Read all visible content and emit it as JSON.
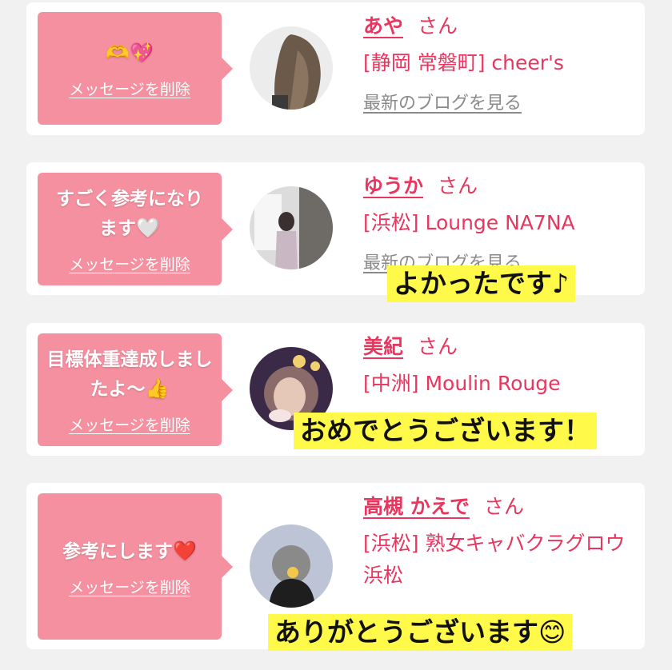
{
  "cards": [
    {
      "message": "",
      "message_emoji": "🫶💖",
      "delete_label": "メッセージを削除",
      "name": "あや",
      "honorific": "さん",
      "shop": "[静岡 常磐町] cheer's",
      "blog_link": "最新のブログを見る"
    },
    {
      "message": "すごく参考になります",
      "message_emoji": "🤍",
      "delete_label": "メッセージを削除",
      "name": "ゆうか",
      "honorific": "さん",
      "shop": "[浜松] Lounge NA7NA",
      "blog_link": "最新のブログを見る"
    },
    {
      "message": "目標体重達成しましたよ〜",
      "message_emoji": "👍",
      "delete_label": "メッセージを削除",
      "name": "美紀",
      "honorific": "さん",
      "shop": "[中洲] Moulin Rouge"
    },
    {
      "message": "参考にします",
      "message_emoji": "❤️",
      "delete_label": "メッセージを削除",
      "name": "高槻 かえで",
      "honorific": "さん",
      "shop": "[浜松] 熟女キャバクラグロウ 浜松"
    }
  ],
  "captions": [
    "よかったです♪",
    "おめでとうございます！",
    "ありがとうございます😊"
  ],
  "colors": {
    "background": "#f1f1f1",
    "bubble": "#f590a0",
    "accent": "#e8365f",
    "caption_highlight": "#fff94a"
  }
}
